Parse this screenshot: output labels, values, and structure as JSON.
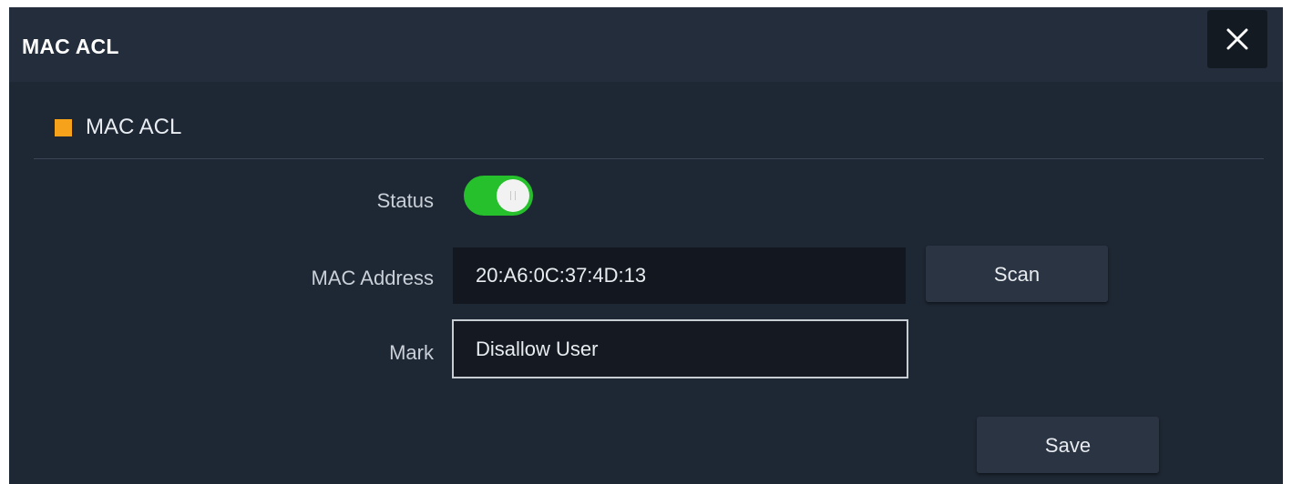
{
  "dialog": {
    "title": "MAC ACL",
    "close_icon": "close-icon"
  },
  "section": {
    "title": "MAC ACL",
    "accent_color": "#f6a31b"
  },
  "form": {
    "status": {
      "label": "Status",
      "enabled": true,
      "on_color": "#25c02b"
    },
    "mac_address": {
      "label": "MAC Address",
      "value": "20:A6:0C:37:4D:13"
    },
    "mark": {
      "label": "Mark",
      "value": "Disallow User"
    },
    "scan_label": "Scan",
    "save_label": "Save"
  }
}
